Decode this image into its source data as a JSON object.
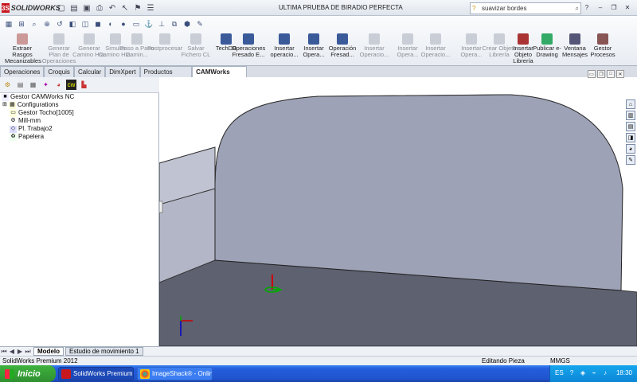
{
  "app": {
    "brand": "SOLIDWORKS",
    "document_title": "ULTIMA PRUEBA DE BIRADIO PERFECTA"
  },
  "search": {
    "value": "suavizar bordes"
  },
  "window_buttons": [
    "minimize",
    "restore",
    "close",
    "help"
  ],
  "toolbar": {
    "buttons": [
      {
        "label": "Extraer Rasgos Mecanizables",
        "enabled": true,
        "icon": "extract-features-icon"
      },
      {
        "label": "Generar Plan de Operaciones",
        "enabled": false,
        "icon": "generate-plan-icon"
      },
      {
        "label": "Generar Camino Hta.",
        "enabled": false,
        "icon": "generate-toolpath-icon"
      },
      {
        "label": "Simular Camino Hta.",
        "enabled": false,
        "icon": "simulate-toolpath-icon"
      },
      {
        "label": "Paso a Paso Camin...",
        "enabled": false,
        "icon": "step-through-icon"
      },
      {
        "label": "Postprocesar",
        "enabled": false,
        "icon": "post-process-icon"
      },
      {
        "label": "Salvar Fichero CL",
        "enabled": false,
        "icon": "save-cl-icon"
      },
      {
        "label": "TechDB",
        "enabled": true,
        "icon": "techdb-icon"
      },
      {
        "label": "Operaciones Fresado E...",
        "enabled": true,
        "icon": "mill-ops-icon"
      },
      {
        "label": "Insertar operacio...",
        "enabled": true,
        "icon": "insert-op-icon"
      },
      {
        "label": "Insertar Opera...",
        "enabled": true,
        "icon": "insert-op2-icon"
      },
      {
        "label": "Operación Fresad...",
        "enabled": true,
        "icon": "mill-op-icon"
      },
      {
        "label": "Insertar Operacio...",
        "enabled": false,
        "icon": "insert-op3-icon"
      },
      {
        "label": "Insertar Opera...",
        "enabled": false,
        "icon": "insert-op4-icon"
      },
      {
        "label": "Insertar Operacio...",
        "enabled": false,
        "icon": "insert-op5-icon"
      },
      {
        "label": "Insertar Opera...",
        "enabled": false,
        "icon": "insert-op6-icon"
      },
      {
        "label": "Crear Objeto Librería",
        "enabled": false,
        "icon": "create-library-icon"
      },
      {
        "label": "Insertar Objeto Librería",
        "enabled": true,
        "icon": "insert-library-icon"
      },
      {
        "label": "Publicar e-Drawing",
        "enabled": true,
        "icon": "edrawing-icon"
      },
      {
        "label": "Ventana Mensajes",
        "enabled": true,
        "icon": "messages-icon"
      },
      {
        "label": "Gestor Procesos",
        "enabled": true,
        "icon": "process-manager-icon"
      }
    ]
  },
  "tabs": [
    "Operaciones",
    "Croquis",
    "Calcular",
    "DimXpert",
    "Productos Office",
    "CAMWorks 2012"
  ],
  "active_tab": "CAMWorks 2012",
  "tree": {
    "items": [
      {
        "label": "Gestor CAMWorks NC",
        "indent": 0,
        "icon": "cam-manager-icon"
      },
      {
        "label": "Configurations",
        "indent": 1,
        "icon": "configurations-icon"
      },
      {
        "label": "Gestor Tocho[1005]",
        "indent": 1,
        "icon": "stock-icon"
      },
      {
        "label": "Mill-mm",
        "indent": 1,
        "icon": "machine-icon"
      },
      {
        "label": "Pl. Trabajo2",
        "indent": 1,
        "icon": "plane-icon"
      },
      {
        "label": "Papelera",
        "indent": 1,
        "icon": "recycle-icon"
      }
    ]
  },
  "bottom_tabs": [
    "Modelo",
    "Estudio de movimiento 1"
  ],
  "status": {
    "left": "SolidWorks Premium 2012",
    "mode": "Editando Pieza",
    "units": "MMGS"
  },
  "taskbar": {
    "start_label": "Inicio",
    "tasks": [
      "SolidWorks Premium 2...",
      "ImageShack® - Onlin..."
    ],
    "lang": "ES",
    "time": "18:30"
  },
  "colors": {
    "part_face": "#9ea2b6",
    "part_top": "#878a9f",
    "part_floor": "#5e6170",
    "part_left": "#b3b6c6",
    "accent": "#3a5a9a"
  }
}
